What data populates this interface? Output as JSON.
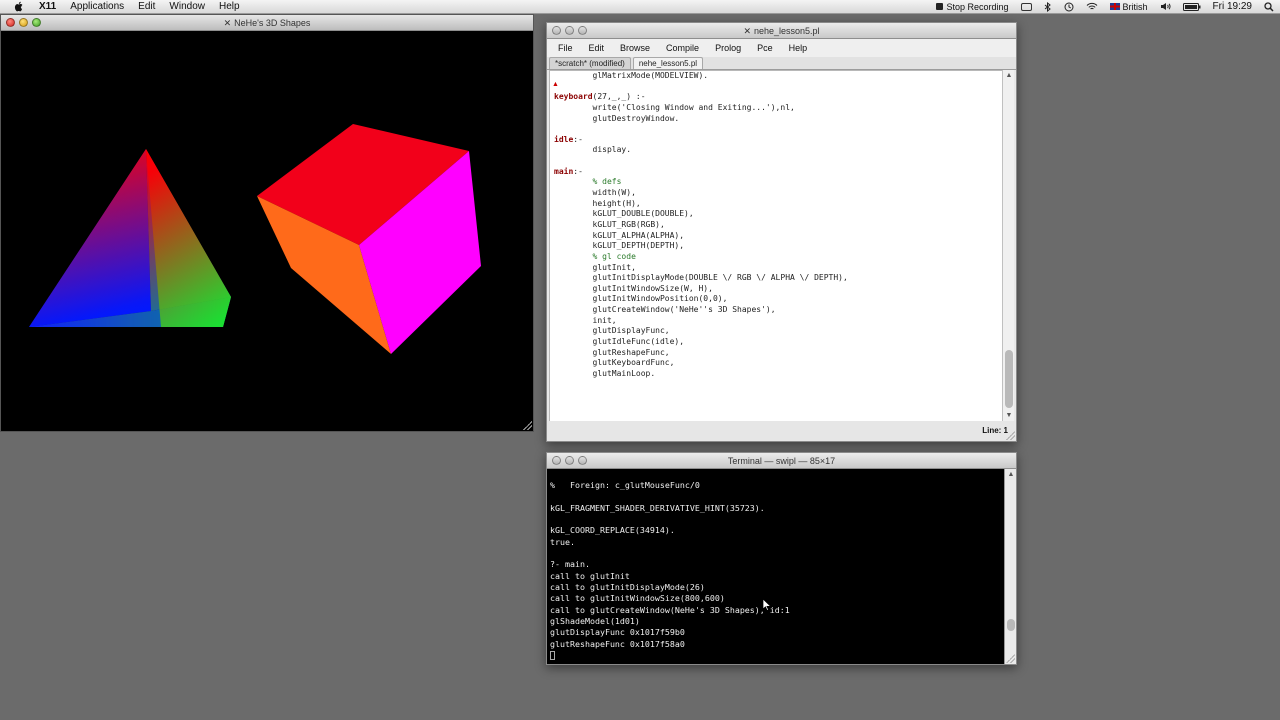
{
  "menubar": {
    "app": "X11",
    "items": [
      "Applications",
      "Edit",
      "Window",
      "Help"
    ],
    "status_recording": "Stop Recording",
    "input_source": "British",
    "clock": "Fri 19:29"
  },
  "gl_window": {
    "title": "NeHe's 3D Shapes"
  },
  "editor": {
    "title": "nehe_lesson5.pl",
    "menu": [
      "File",
      "Edit",
      "Browse",
      "Compile",
      "Prolog",
      "Pce",
      "Help"
    ],
    "tabs": [
      "*scratch* (modified)",
      "nehe_lesson5.pl"
    ],
    "status_label": "Line:",
    "status_value": "1",
    "code_lines": [
      {
        "i": "        ",
        "t": "glMatrixMode(MODELVIEW)."
      },
      {
        "i": "",
        "t": ""
      },
      {
        "i": "",
        "h": "keyboard",
        "t": "(27,_,_) :-"
      },
      {
        "i": "        ",
        "t": "write('Closing Window and Exiting...'),nl,"
      },
      {
        "i": "        ",
        "t": "glutDestroyWindow."
      },
      {
        "i": "",
        "t": ""
      },
      {
        "i": "",
        "h": "idle",
        "t": ":-"
      },
      {
        "i": "        ",
        "t": "display."
      },
      {
        "i": "",
        "t": ""
      },
      {
        "i": "",
        "h": "main",
        "t": ":-"
      },
      {
        "i": "        ",
        "c": "% defs"
      },
      {
        "i": "        ",
        "t": "width(W),"
      },
      {
        "i": "        ",
        "t": "height(H),"
      },
      {
        "i": "        ",
        "t": "kGLUT_DOUBLE(DOUBLE),"
      },
      {
        "i": "        ",
        "t": "kGLUT_RGB(RGB),"
      },
      {
        "i": "        ",
        "t": "kGLUT_ALPHA(ALPHA),"
      },
      {
        "i": "        ",
        "t": "kGLUT_DEPTH(DEPTH),"
      },
      {
        "i": "        ",
        "c": "% gl code"
      },
      {
        "i": "        ",
        "t": "glutInit,"
      },
      {
        "i": "        ",
        "t": "glutInitDisplayMode(DOUBLE \\/ RGB \\/ ALPHA \\/ DEPTH),"
      },
      {
        "i": "        ",
        "t": "glutInitWindowSize(W, H),"
      },
      {
        "i": "        ",
        "t": "glutInitWindowPosition(0,0),"
      },
      {
        "i": "        ",
        "t": "glutCreateWindow('NeHe''s 3D Shapes'),"
      },
      {
        "i": "        ",
        "t": "init,"
      },
      {
        "i": "        ",
        "t": "glutDisplayFunc,"
      },
      {
        "i": "        ",
        "t": "glutIdleFunc(idle),"
      },
      {
        "i": "        ",
        "t": "glutReshapeFunc,"
      },
      {
        "i": "        ",
        "t": "glutKeyboardFunc,"
      },
      {
        "i": "        ",
        "t": "glutMainLoop."
      }
    ]
  },
  "terminal": {
    "title": "Terminal — swipl — 85×17",
    "lines": [
      "%   Foreign: c_glutMouseFunc/0",
      "",
      "kGL_FRAGMENT_SHADER_DERIVATIVE_HINT(35723).",
      "",
      "kGL_COORD_REPLACE(34914).",
      "true.",
      "",
      "?- main.",
      "call to glutInit",
      "call to glutInitDisplayMode(26)",
      "call to glutInitWindowSize(800,600)",
      "call to glutCreateWindow(NeHe's 3D Shapes), id:1",
      "glShadeModel(1d01)",
      "glutDisplayFunc 0x1017f59b0",
      "glutReshapeFunc 0x1017f58a0"
    ]
  },
  "colors": {
    "cube_top": "#f2001a",
    "cube_left": "#ff6a1a",
    "cube_right": "#ff00ff",
    "predicate": "#8b0000",
    "comment": "#2a7a2a"
  }
}
